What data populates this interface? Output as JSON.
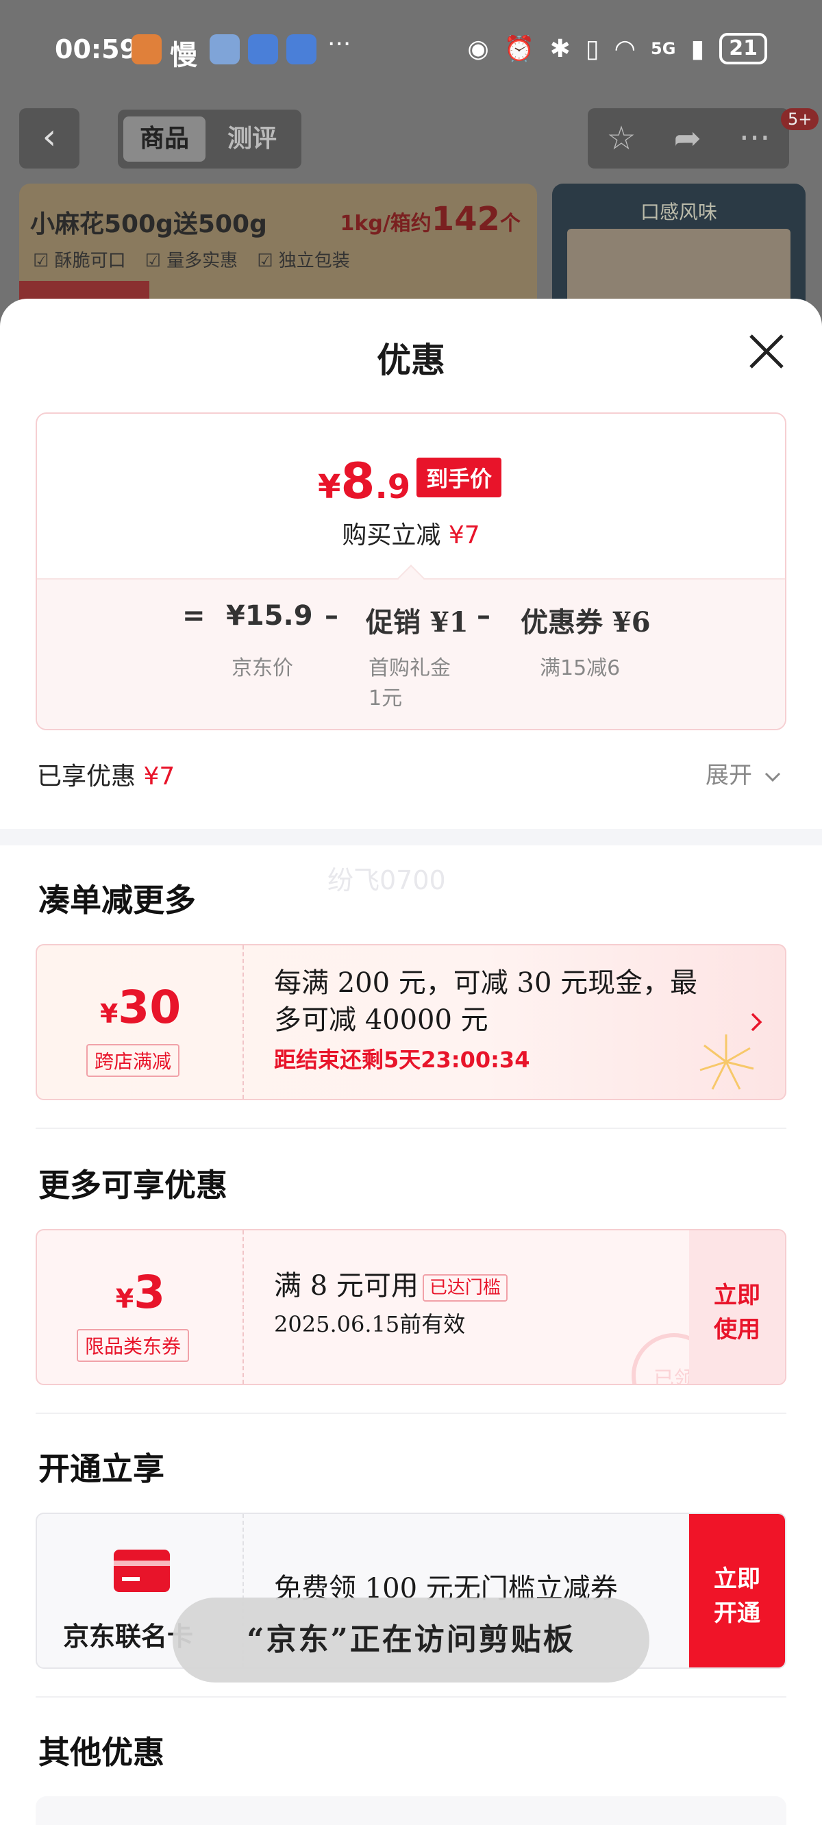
{
  "status_bar": {
    "time": "00:59",
    "slow_label": "慢",
    "network": "5G",
    "battery": "21"
  },
  "background_page": {
    "tabs": [
      "商品",
      "测评"
    ],
    "badge": "5+",
    "product_title": "小麻花500g送500g",
    "product_price_prefix": "1kg/箱约",
    "product_price_count": "142",
    "product_price_suffix": "个",
    "features": [
      "酥脆可口",
      "量多实惠",
      "独立包装"
    ],
    "side_title": "口感风味"
  },
  "sheet": {
    "title": "优惠",
    "final_price": {
      "symbol": "¥",
      "integer": "8",
      "decimal": ".9"
    },
    "price_tag": "到手价",
    "reduce_label": "购买立减",
    "reduce_amount": "¥7",
    "formula": {
      "equals": "=",
      "base_price": "¥15.9",
      "base_label": "京东价",
      "minus1": "–",
      "promo": "促销 ¥1",
      "promo_label_line1": "首购礼金",
      "promo_label_line2": "1元",
      "minus2": "–",
      "coupon": "优惠券 ¥6",
      "coupon_label": "满15减6"
    },
    "enjoyed_label": "已享优惠",
    "enjoyed_amount": "¥7",
    "expand_label": "展开",
    "watermark": "纷飞0700"
  },
  "sections": {
    "bundle": {
      "title": "凑单减更多",
      "coupon": {
        "symbol": "¥",
        "amount": "30",
        "tag": "跨店满减",
        "text_line1": "每满 200 元，可减 30 元现金，最",
        "text_line2": "多可减 40000 元",
        "countdown": "距结束还剩5天23:00:34"
      }
    },
    "more": {
      "title": "更多可享优惠",
      "coupon": {
        "symbol": "¥",
        "amount": "3",
        "tag": "限品类东券",
        "condition": "满 8 元可用",
        "threshold_tag": "已达门槛",
        "validity": "2025.06.15前有效",
        "stamp": "已领",
        "button_line1": "立即",
        "button_line2": "使用"
      }
    },
    "open": {
      "title": "开通立享",
      "card_name": "京东联名卡",
      "text": "免费领 100 元无门槛立减券",
      "button_line1": "立即",
      "button_line2": "开通"
    },
    "other": {
      "title": "其他优惠"
    }
  },
  "toast": "“京东”正在访问剪贴板"
}
